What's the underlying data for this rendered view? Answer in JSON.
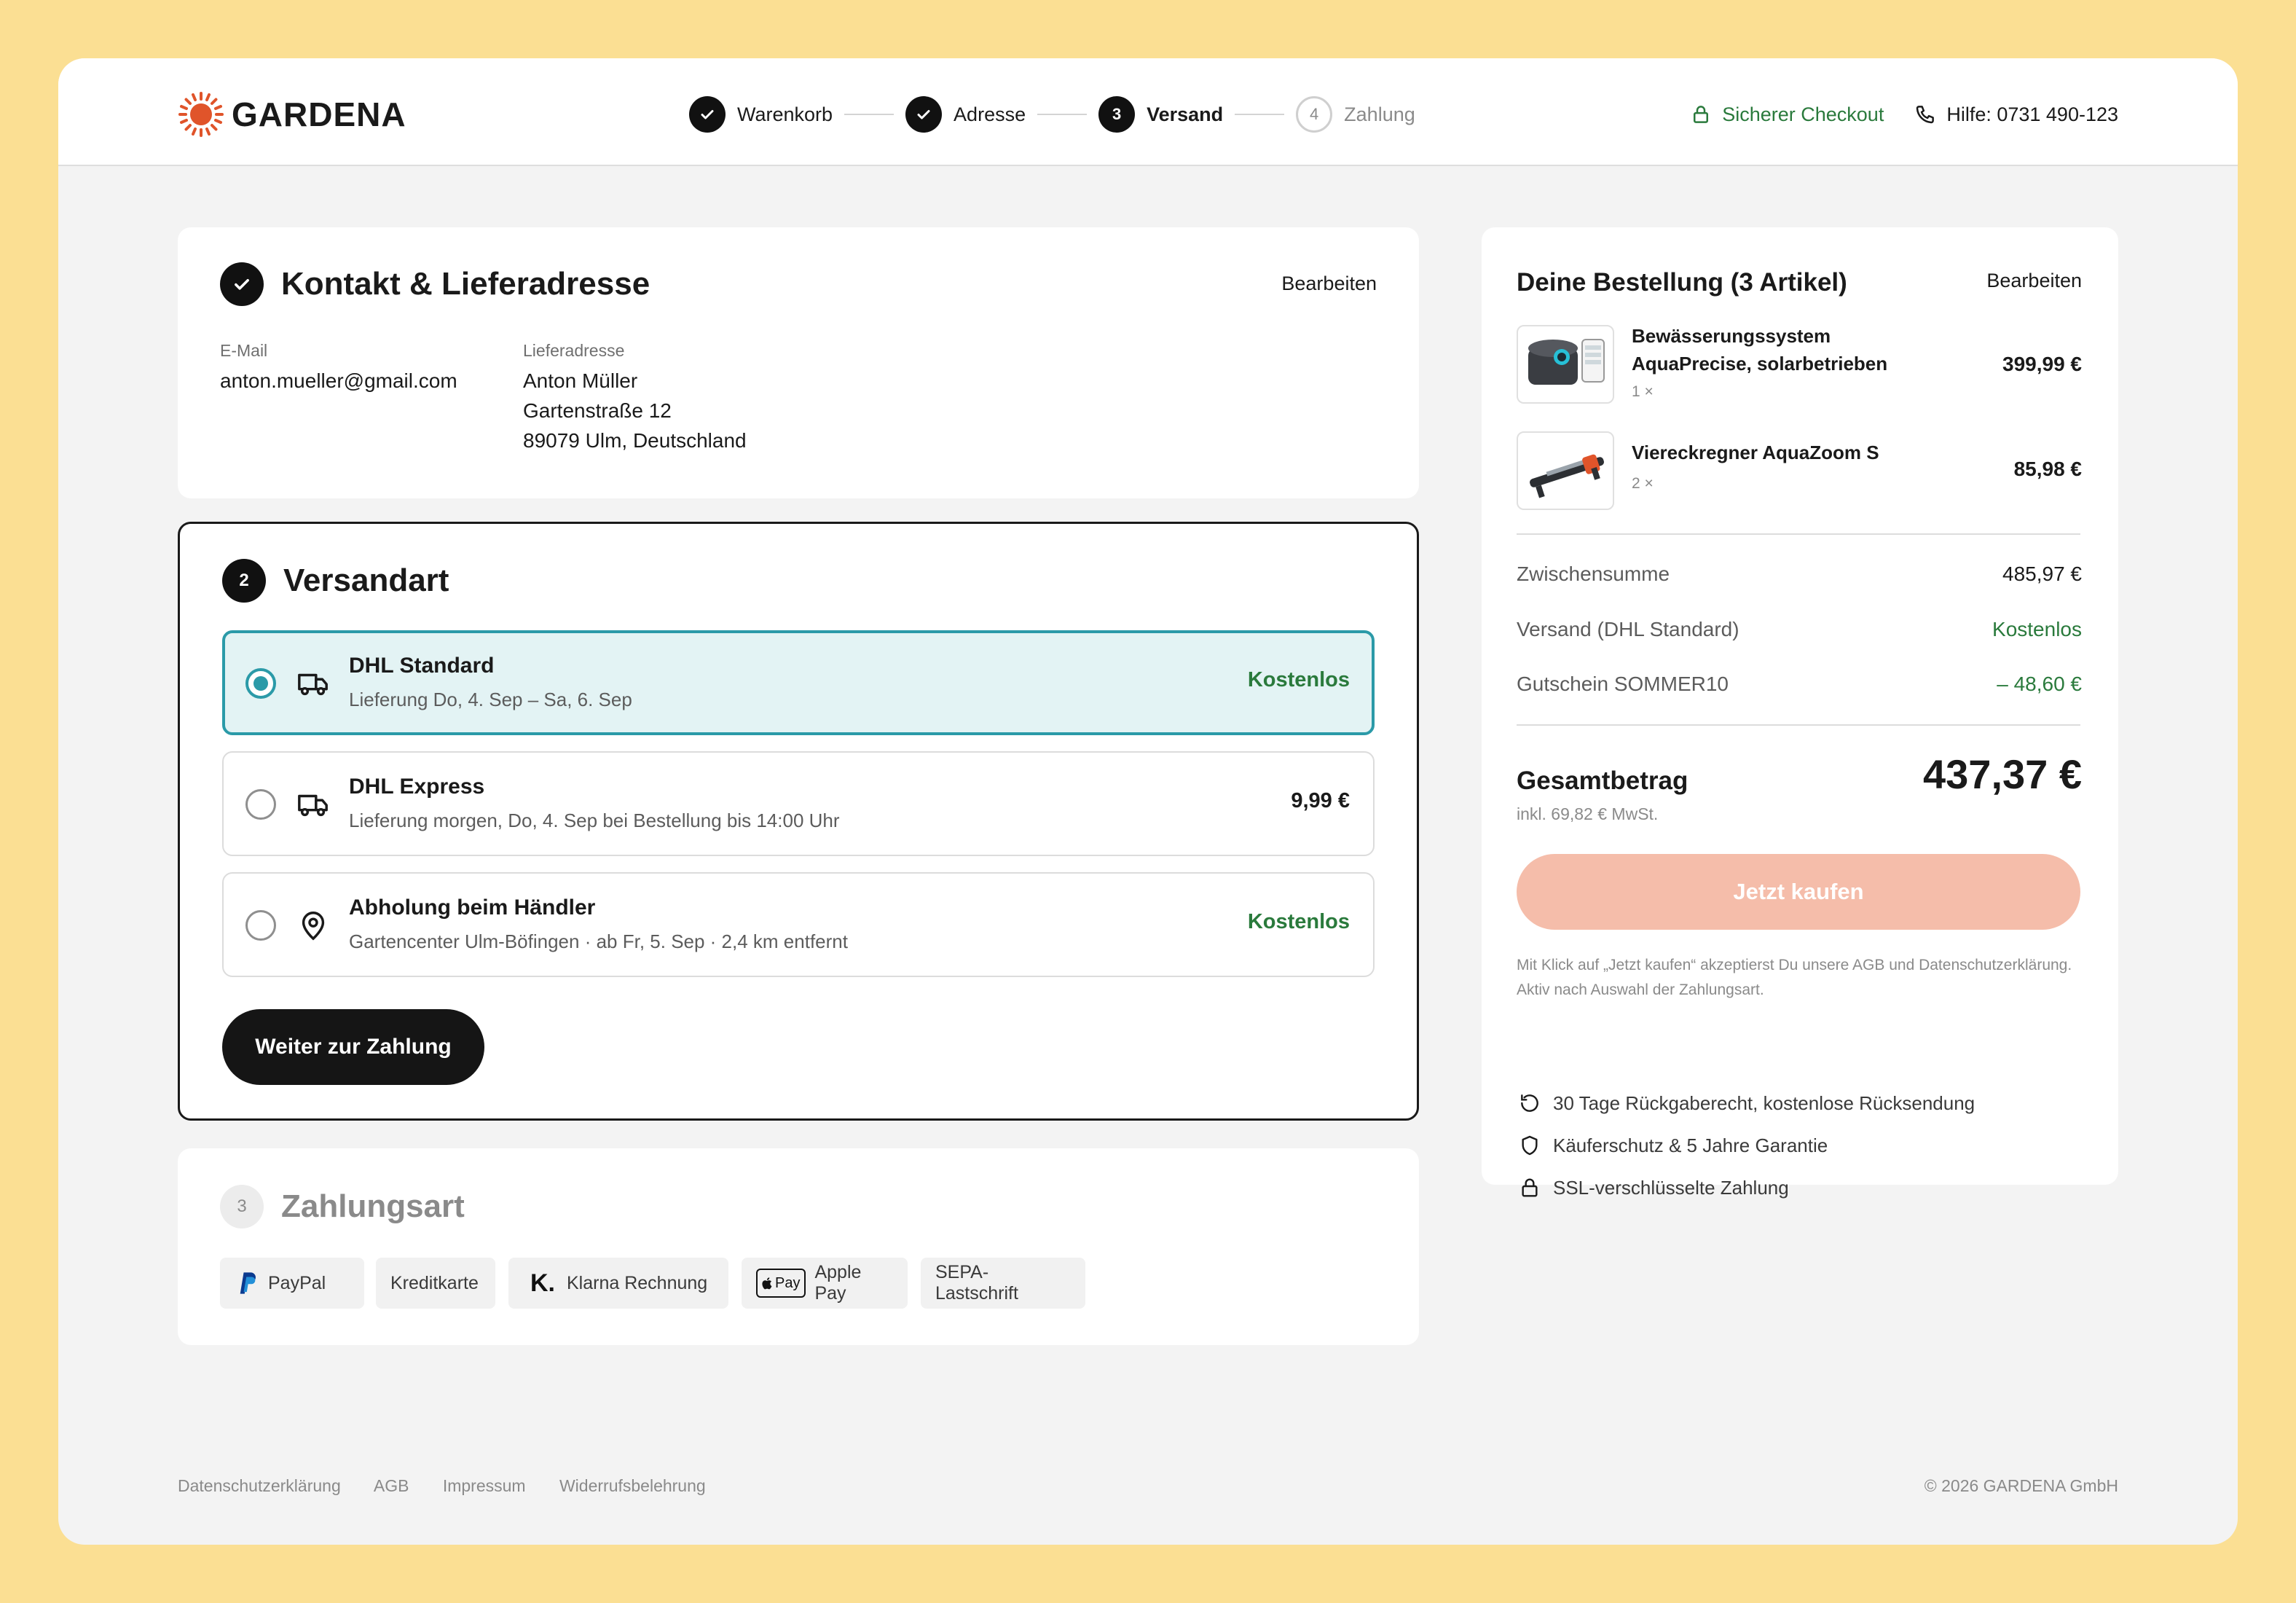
{
  "brand": {
    "name": "GARDENA",
    "accent": "#e0542a"
  },
  "stepper": [
    {
      "num": "",
      "label": "Warenkorb",
      "state": "done"
    },
    {
      "num": "",
      "label": "Adresse",
      "state": "done"
    },
    {
      "num": "3",
      "label": "Versand",
      "state": "current"
    },
    {
      "num": "4",
      "label": "Zahlung",
      "state": "todo"
    }
  ],
  "header": {
    "secure": "Sicherer Checkout",
    "help": "Hilfe: 0731 490-123"
  },
  "contact": {
    "title": "Kontakt & Lieferadresse",
    "edit": "Bearbeiten",
    "email_label": "E-Mail",
    "email": "anton.mueller@gmail.com",
    "address_label": "Lieferadresse",
    "address_lines": [
      "Anton Müller",
      "Gartenstraße 12",
      "89079 Ulm, Deutschland"
    ]
  },
  "shipping": {
    "step": "2",
    "title": "Versandart",
    "options": [
      {
        "title": "DHL Standard",
        "sub": "Lieferung Do, 4. Sep – Sa, 6. Sep",
        "price": "Kostenlos",
        "selected": true,
        "icon": "truck-icon"
      },
      {
        "title": "DHL Express",
        "sub": "Lieferung morgen, Do, 4. Sep bei Bestellung bis 14:00 Uhr",
        "price": "9,99 €",
        "selected": false,
        "icon": "truck-icon"
      },
      {
        "title": "Abholung beim Händler",
        "sub": "Gartencenter Ulm-Böfingen · ab Fr, 5. Sep · 2,4 km entfernt",
        "price": "Kostenlos",
        "selected": false,
        "icon": "map-pin-icon"
      }
    ],
    "continue": "Weiter zur Zahlung"
  },
  "payment": {
    "step": "3",
    "title": "Zahlungsart",
    "methods": [
      "PayPal",
      "Kreditkarte",
      "Klarna Rechnung",
      "Apple Pay",
      "SEPA-Lastschrift"
    ],
    "applepay_badge": "Pay"
  },
  "summary": {
    "title": "Deine Bestellung (3 Artikel)",
    "edit": "Bearbeiten",
    "items": [
      {
        "name": "Bewässerungssystem AquaPrecise, solarbetrieben",
        "qty": "1 ×",
        "price": "399,99 €"
      },
      {
        "name": "Viereckregner AquaZoom S",
        "qty": "2 ×",
        "price": "85,98 €"
      }
    ],
    "rows": [
      {
        "label": "Zwischensumme",
        "value": "485,97 €"
      },
      {
        "label": "Versand (DHL Standard)",
        "value": "Kostenlos"
      },
      {
        "label": "Gutschein SOMMER10",
        "value": "– 48,60 €"
      }
    ],
    "total_label": "Gesamtbetrag",
    "total": "437,37 €",
    "vat": "inkl. 69,82 € MwSt.",
    "buy": "Jetzt kaufen",
    "legal": "Mit Klick auf „Jetzt kaufen“ akzeptierst Du unsere AGB und Datenschutzerklärung. Aktiv nach Auswahl der Zahlungsart.",
    "trust": [
      {
        "icon": "return-icon",
        "text": "30 Tage Rückgaberecht, kostenlose Rücksendung"
      },
      {
        "icon": "shield-icon",
        "text": "Käuferschutz & 5 Jahre Garantie"
      },
      {
        "icon": "lock-icon",
        "text": "SSL-verschlüsselte Zahlung"
      }
    ]
  },
  "footer": {
    "links": [
      "Datenschutzerklärung",
      "AGB",
      "Impressum",
      "Widerrufsbelehrung"
    ],
    "copyright": "© 2026 GARDENA GmbH"
  },
  "colors": {
    "teal": "#2b9aa8",
    "green": "#2a7a3c",
    "buy_disabled": "#f5bdaa",
    "page_bg": "#fbdf93"
  }
}
